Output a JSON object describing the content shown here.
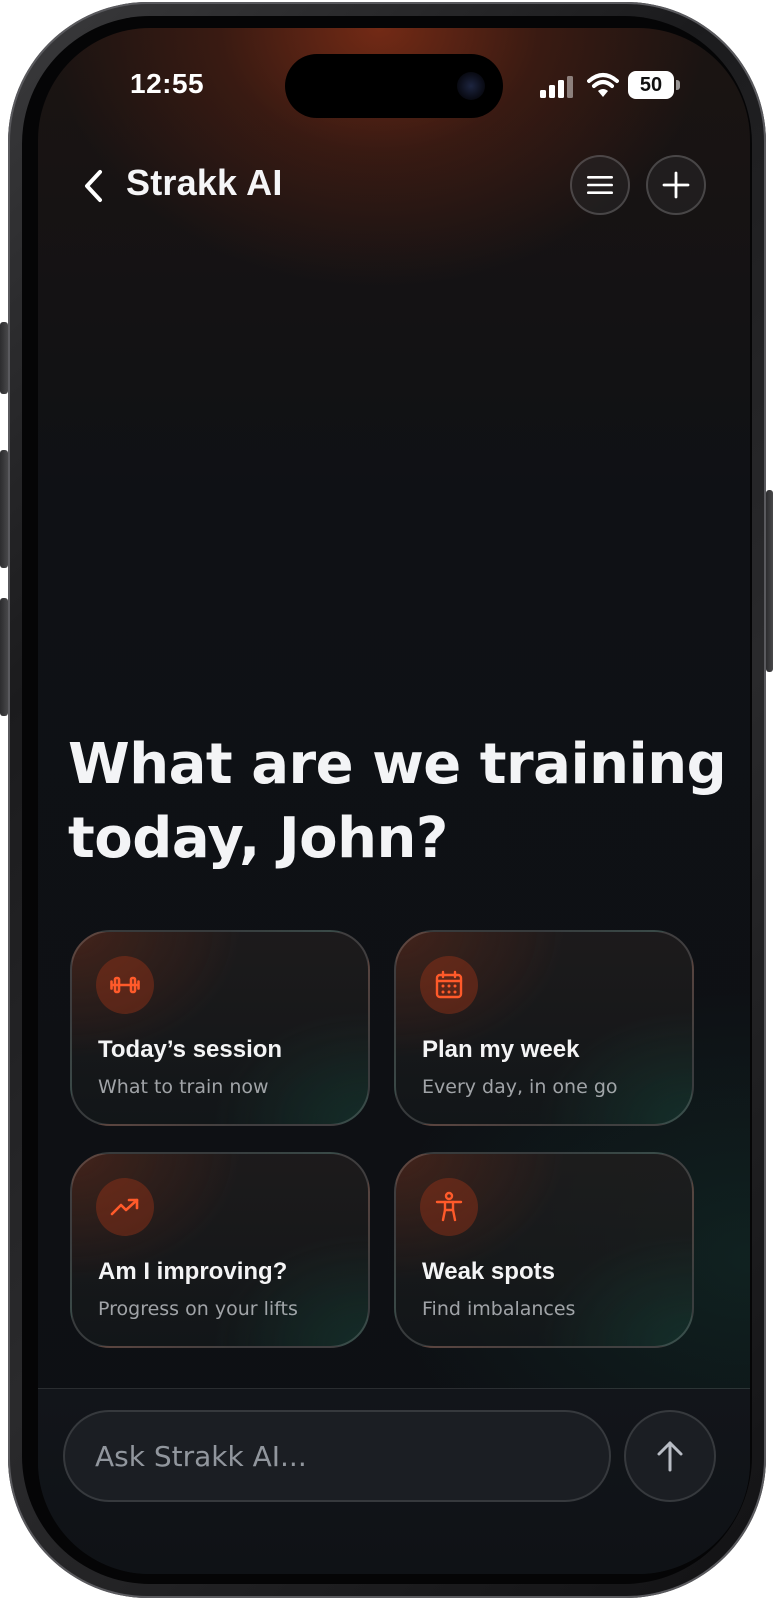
{
  "status_bar": {
    "time": "12:55",
    "battery_level": "50",
    "signal_icon": "cellular-signal-icon",
    "wifi_icon": "wifi-icon"
  },
  "header": {
    "back_icon": "chevron-left-icon",
    "title": "Strakk AI",
    "menu_icon": "hamburger-menu-icon",
    "add_icon": "plus-icon"
  },
  "hero": {
    "line1": "What are we training",
    "line2": "today, John?"
  },
  "suggestions": [
    {
      "icon": "dumbbell-icon",
      "title": "Today’s session",
      "subtitle": "What to train now"
    },
    {
      "icon": "calendar-icon",
      "title": "Plan my week",
      "subtitle": "Every day, in one go"
    },
    {
      "icon": "trending-up-icon",
      "title": "Am I improving?",
      "subtitle": "Progress on your lifts"
    },
    {
      "icon": "body-figure-icon",
      "title": "Weak spots",
      "subtitle": "Find imbalances"
    }
  ],
  "composer": {
    "placeholder": "Ask Strakk AI...",
    "value": "",
    "send_icon": "arrow-up-icon"
  },
  "colors": {
    "accent": "#FF5A2A",
    "background": "#0E1115",
    "text_primary": "#F3F4F6",
    "text_secondary": "#AEB2B8"
  }
}
